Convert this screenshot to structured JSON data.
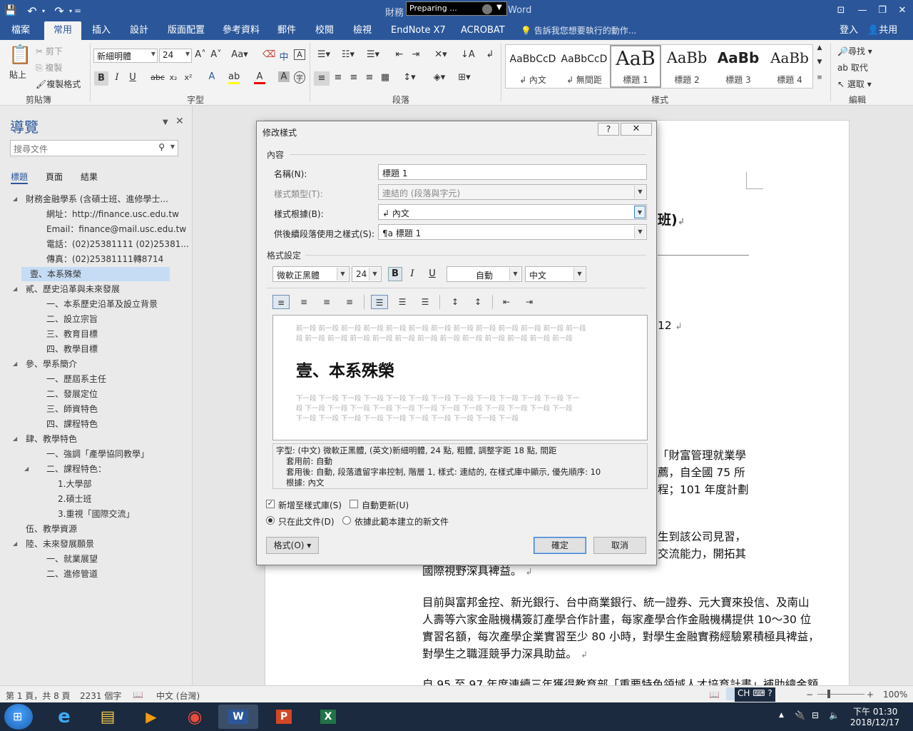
{
  "titlebar": {
    "title_visible": "財務",
    "title_end": "Word",
    "preparing": "Preparing ...",
    "qat_save": "💾",
    "qat_undo": "↶",
    "qat_redo": "↷",
    "qat_more": "=",
    "win_ribbon": "⊡",
    "win_min": "—",
    "win_restore": "❐",
    "win_close": "✕"
  },
  "tabs": {
    "items": [
      "檔案",
      "常用",
      "插入",
      "設計",
      "版面配置",
      "參考資料",
      "郵件",
      "校閱",
      "檢視",
      "EndNote X7",
      "ACROBAT"
    ],
    "tell_me": "告訴我您想要執行的動作...",
    "signin": "登入",
    "share": "共用"
  },
  "ribbon": {
    "clipboard": {
      "paste": "貼上",
      "cut": "剪下",
      "copy": "複製",
      "format_painter": "複製格式",
      "label": "剪貼簿"
    },
    "font": {
      "name": "新細明體",
      "size": "24",
      "label": "字型"
    },
    "paragraph": {
      "label": "段落"
    },
    "styles": {
      "label": "樣式",
      "items": [
        {
          "sample": "AaBbCcD",
          "name": "↲ 內文"
        },
        {
          "sample": "AaBbCcD",
          "name": "↲ 無間距"
        },
        {
          "sample": "AaB",
          "name": "標題 1"
        },
        {
          "sample": "AaBb",
          "name": "標題 2"
        },
        {
          "sample": "AaBb",
          "name": "標題 3"
        },
        {
          "sample": "AaBb",
          "name": "標題 4"
        }
      ]
    },
    "editing": {
      "find": "尋找",
      "replace": "取代",
      "select": "選取",
      "label": "編輯"
    }
  },
  "nav": {
    "title": "導覽",
    "search_placeholder": "搜尋文件",
    "tabs": [
      "標題",
      "頁面",
      "結果"
    ],
    "items": [
      {
        "text": "財務金融學系 (含碩士班、進修學士...",
        "level": 0,
        "expand": true
      },
      {
        "text": "網址：http://finance.usc.edu.tw",
        "level": 1
      },
      {
        "text": "Email：finance@mail.usc.edu.tw",
        "level": 1
      },
      {
        "text": "電話：(02)25381111 (02)25381...",
        "level": 1
      },
      {
        "text": "傳真：(02)25381111轉8714",
        "level": 1
      },
      {
        "text": "壹、本系殊榮",
        "level": 0,
        "selected": true
      },
      {
        "text": "貳、歷史沿革與未來發展",
        "level": 0,
        "expand": true
      },
      {
        "text": "一、本系歷史沿革及設立背景",
        "level": 1
      },
      {
        "text": "二、設立宗旨",
        "level": 1
      },
      {
        "text": "三、教育目標",
        "level": 1
      },
      {
        "text": "四、教學目標",
        "level": 1
      },
      {
        "text": "參、學系簡介",
        "level": 0,
        "expand": true
      },
      {
        "text": "一、歷屆系主任",
        "level": 1
      },
      {
        "text": "二、發展定位",
        "level": 1
      },
      {
        "text": "三、師資特色",
        "level": 1
      },
      {
        "text": "四、課程特色",
        "level": 1
      },
      {
        "text": "肆、教學特色",
        "level": 0,
        "expand": true
      },
      {
        "text": "一、強調「產學協同教學」",
        "level": 1
      },
      {
        "text": "二、課程特色：",
        "level": 1,
        "expand": true
      },
      {
        "text": "1.大學部",
        "level": 2
      },
      {
        "text": "2.碩士班",
        "level": 2
      },
      {
        "text": "3.重視「國際交流」",
        "level": 2
      },
      {
        "text": "伍、教學資源",
        "level": 0
      },
      {
        "text": "陸、未來發展願景",
        "level": 0,
        "expand": true
      },
      {
        "text": "一、就業展望",
        "level": 1
      },
      {
        "text": "二、進修管道",
        "level": 1
      }
    ]
  },
  "document": {
    "frag_title": "班)",
    "frag_12": "12",
    "frag_l1": "「財富管理就業學",
    "frag_l2": "薦，自全國 75 所",
    "frag_l3": "程；101 年度計劃",
    "frag_l4": "生到該公司見習，",
    "frag_l5": "交流能力，開拓其",
    "para_tail": "國際視野深具裨益。",
    "para2": [
      "目前與富邦金控、新光銀行、台中商業銀行、統一證券、元大寶來投信、及南山",
      "人壽等六家金融機構簽訂產學合作計畫，每家產學合作金融機構提供 10～30 位",
      "實習名額，每次產學企業實習至少 80 小時，對學生金融實務經驗累積極具裨益，",
      "對學生之職涯競爭力深具助益。"
    ],
    "para3": "自 95 至 97 年度連續三年獲得教育部「重要特色領域人才培育計畫」補助總金額"
  },
  "dialog": {
    "title": "修改樣式",
    "help": "?",
    "close": "✕",
    "section_props": "內容",
    "name_label": "名稱(N):",
    "name_value": "標題 1",
    "type_label": "樣式類型(T):",
    "type_value": "連結的 (段落與字元)",
    "based_label": "樣式根據(B):",
    "based_value": "↲ 內文",
    "next_label": "供後續段落使用之樣式(S):",
    "next_value": "標題 1",
    "section_format": "格式設定",
    "font_value": "微軟正黑體",
    "size_value": "24",
    "bold": "B",
    "italic": "I",
    "underline": "U",
    "color_value": "自動",
    "lang_value": "中文",
    "preview_prev": [
      "前一段 前一段 前一段 前一段 前一段 前一段 前一段 前一段 前一段 前一段 前一段 前一段 前一段",
      "段 前一段 前一段 前一段 前一段 前一段 前一段 前一段 前一段 前一段 前一段 前一段 前一段"
    ],
    "preview_sample": "壹、本系殊榮",
    "preview_next": [
      "下一段 下一段 下一段 下一段 下一段 下一段 下一段 下一段 下一段 下一段 下一段 下一段 下一",
      "段 下一段 下一段 下一段 下一段 下一段 下一段 下一段 下一段 下一段 下一段 下一段 下一段",
      "下一段 下一段 下一段 下一段 下一段 下一段 下一段 下一段 下一段 下一段"
    ],
    "desc": [
      "字型: (中文) 微軟正黑體, (英文)新細明體, 24 點, 粗體, 調整字距 18 點, 間距",
      "套用前:  自動",
      "套用後:  自動, 段落遺留字串控制, 階層 1, 樣式: 連結的, 在樣式庫中顯示, 優先順序: 10",
      "根據: 內文"
    ],
    "add_gallery": "新增至樣式庫(S)",
    "auto_update": "自動更新(U)",
    "only_doc": "只在此文件(D)",
    "new_docs": "依據此範本建立的新文件",
    "format_btn": "格式(O) ▾",
    "ok": "確定",
    "cancel": "取消"
  },
  "status": {
    "page": "第 1 頁，共 8 頁",
    "words": "2231 個字",
    "lang": "中文 (台灣)",
    "ime": "CH",
    "zoom": "100%"
  },
  "taskbar": {
    "time": "下午 01:30",
    "date": "2018/12/17",
    "apps": [
      {
        "name": "ie",
        "glyph": "e"
      },
      {
        "name": "explorer",
        "glyph": "▤"
      },
      {
        "name": "media",
        "glyph": "▶"
      },
      {
        "name": "chrome",
        "glyph": "◉"
      },
      {
        "name": "word",
        "glyph": "W"
      },
      {
        "name": "powerpoint",
        "glyph": "P"
      },
      {
        "name": "excel",
        "glyph": "X"
      }
    ]
  }
}
